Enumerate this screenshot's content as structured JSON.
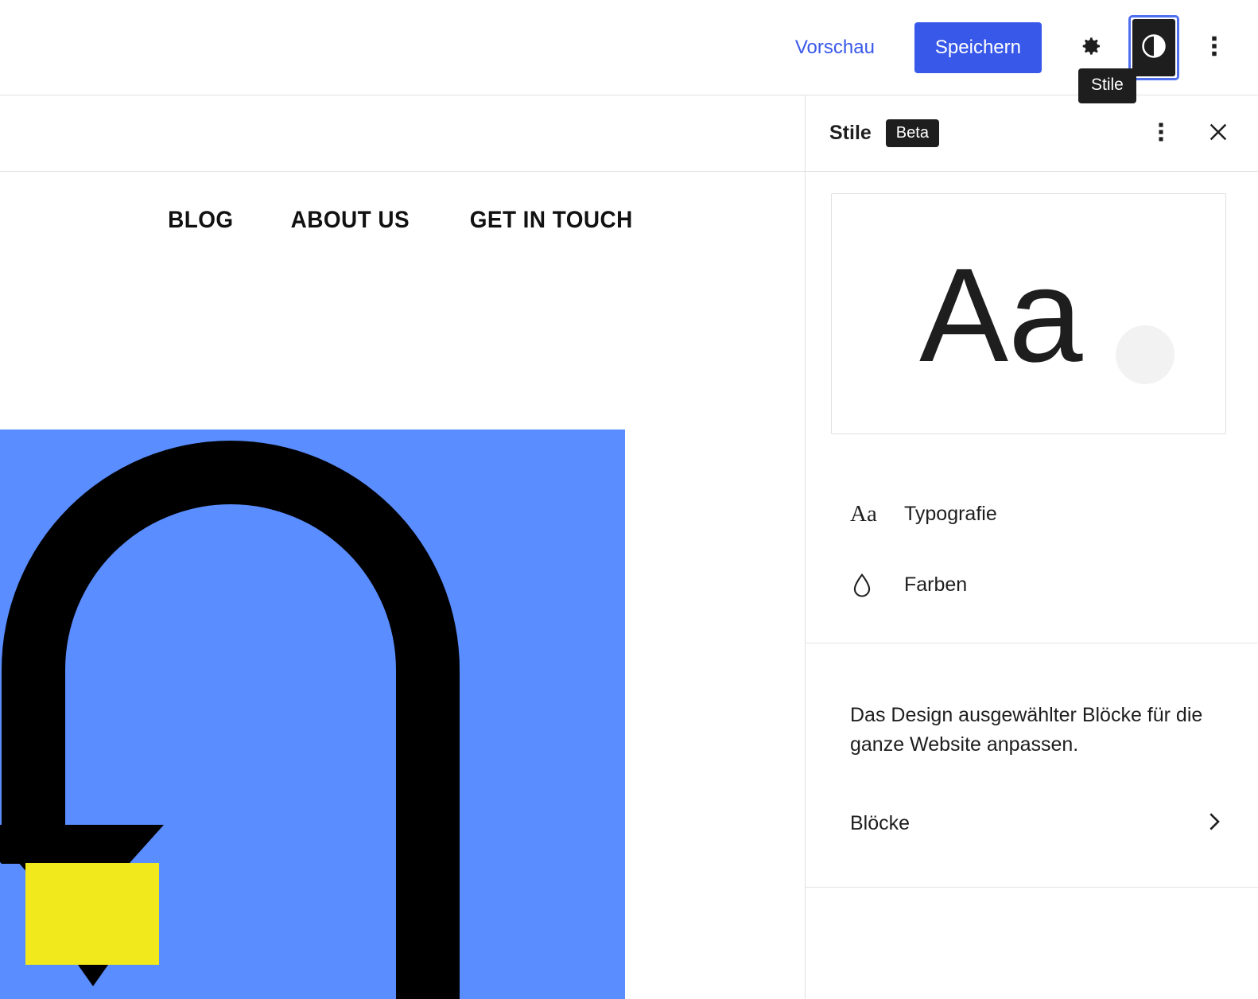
{
  "topbar": {
    "preview_label": "Vorschau",
    "save_label": "Speichern",
    "settings_icon": "gear-icon",
    "styles_icon": "contrast-half-circle-icon",
    "more_icon": "vertical-ellipsis-icon",
    "tooltip": "Stile",
    "accent_color": "#3858e9"
  },
  "canvas": {
    "nav_items": [
      {
        "label": "BLOG"
      },
      {
        "label": "ABOUT US"
      },
      {
        "label": "GET IN TOUCH"
      }
    ],
    "cover_block": {
      "background_color": "#5a8dff",
      "shape_color": "#000000",
      "accent_color": "#f2e91c"
    }
  },
  "sidebar": {
    "title": "Stile",
    "badge": "Beta",
    "more_icon": "vertical-ellipsis-icon",
    "close_icon": "close-icon",
    "preview": {
      "sample_text": "Aa",
      "swatch_color": "#f2f2f2"
    },
    "menu": [
      {
        "icon": "typography-aa-icon",
        "icon_glyph": "Aa",
        "label": "Typografie"
      },
      {
        "icon": "color-drop-icon",
        "label": "Farben"
      }
    ],
    "blocks_section": {
      "description": "Das Design ausgewählter Blöcke für die ganze Website anpassen.",
      "row_label": "Blöcke",
      "chevron_icon": "chevron-right-icon"
    }
  }
}
